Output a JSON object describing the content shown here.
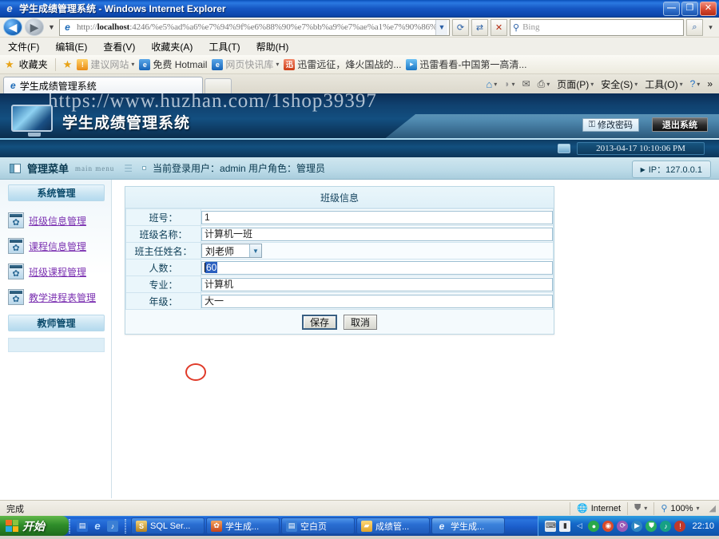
{
  "window": {
    "title": "学生成绩管理系统 - Windows Internet Explorer",
    "minimize_label": "—",
    "maximize_label": "❐",
    "close_label": "✕"
  },
  "address_bar": {
    "url_prefix": "http://",
    "url_host": "localhost",
    "url_rest": ":4246/%e5%ad%a6%e7%94%9f%e6%88%90%e7%bb%a9%e7%ae%a1%e7%90%86%e7%b3%bb",
    "dropdown_icon": "▼",
    "refresh_icon": "⟳",
    "stop_icon": "✕",
    "back_icon": "◀",
    "forward_icon": "▶",
    "history_icon": "▼"
  },
  "search": {
    "placeholder": "Bing",
    "icon": "search-icon",
    "go_icon": "⌕",
    "dropdown_icon": "▾"
  },
  "menu": {
    "items": [
      {
        "label": "文件(F)"
      },
      {
        "label": "编辑(E)"
      },
      {
        "label": "查看(V)"
      },
      {
        "label": "收藏夹(A)"
      },
      {
        "label": "工具(T)"
      },
      {
        "label": "帮助(H)"
      }
    ]
  },
  "favorites": {
    "label": "收藏夹",
    "items": [
      {
        "label": "建议网站",
        "icon": "lightbulb-icon",
        "has_arrow": true
      },
      {
        "label": "免费 Hotmail",
        "icon": "ie-icon",
        "has_arrow": false
      },
      {
        "label": "网页快讯库",
        "icon": "ie-icon",
        "has_arrow": true
      },
      {
        "label": "迅雷远征，烽火国战的...",
        "icon": "thunder-icon",
        "has_arrow": false
      },
      {
        "label": "迅雷看看-中国第一高清...",
        "icon": "thunder-play-icon",
        "has_arrow": false
      }
    ]
  },
  "tabs": {
    "active": "学生成绩管理系统",
    "new_tab_label": ""
  },
  "command_bar": {
    "items": [
      {
        "label": "",
        "icon": "home-icon",
        "arrow": "▾"
      },
      {
        "label": "",
        "icon": "feeds-icon",
        "arrow": "▾"
      },
      {
        "label": "",
        "icon": "mail-icon",
        "arrow": ""
      },
      {
        "label": "",
        "icon": "print-icon",
        "arrow": "▾"
      },
      {
        "label": "页面(P)",
        "icon": "",
        "arrow": "▾"
      },
      {
        "label": "安全(S)",
        "icon": "",
        "arrow": "▾"
      },
      {
        "label": "工具(O)",
        "icon": "",
        "arrow": "▾"
      },
      {
        "label": "",
        "icon": "help-icon",
        "arrow": "▾"
      }
    ],
    "overflow": "»"
  },
  "app_header": {
    "watermark": "https://www.huzhan.com/1shop39397",
    "title": "学生成绩管理系统",
    "change_password_label": "修改密码",
    "change_password_icon": "key-icon",
    "logout_label": "退出系统",
    "datetime": "2013-04-17 10:10:06 PM",
    "screen_icon": "monitor-icon"
  },
  "sub_header": {
    "menu_title": "管理菜单",
    "menu_subtitle": "main menu",
    "current_user_text": "当前登录用户：admin 用户角色：管理员",
    "ip_label": "IP：127.0.0.1",
    "ip_arrow": "▶"
  },
  "sidebar": {
    "groups": [
      {
        "type": "header",
        "label": "系统管理"
      },
      {
        "type": "item",
        "label": "班级信息管理",
        "icon": "gear-icon"
      },
      {
        "type": "item",
        "label": "课程信息管理",
        "icon": "gear-icon"
      },
      {
        "type": "item",
        "label": "班级课程管理",
        "icon": "gear-icon"
      },
      {
        "type": "item",
        "label": "教学进程表管理",
        "icon": "gear-icon"
      },
      {
        "type": "header",
        "label": "教师管理"
      }
    ]
  },
  "form": {
    "title": "班级信息",
    "fields": [
      {
        "label": "班号：",
        "value": "1",
        "type": "text"
      },
      {
        "label": "班级名称：",
        "value": "计算机一班",
        "type": "text"
      },
      {
        "label": "班主任姓名：",
        "value": "刘老师",
        "type": "select",
        "arrow": "▼"
      },
      {
        "label": "人数：",
        "value": "60",
        "type": "text-selected"
      },
      {
        "label": "专业：",
        "value": "计算机",
        "type": "text"
      },
      {
        "label": "年级：",
        "value": "大一",
        "type": "text"
      }
    ],
    "save_label": "保存",
    "cancel_label": "取消"
  },
  "status_bar": {
    "message": "完成",
    "zone": "Internet",
    "zone_icon": "globe-icon",
    "protected_icon": "lock-icon",
    "zoom": "100%",
    "zoom_icon": "magnifier-icon",
    "dropdown": "▾"
  },
  "taskbar": {
    "start_label": "开始",
    "quick_launch": [
      {
        "icon": "show-desktop-icon"
      },
      {
        "icon": "ie-icon"
      },
      {
        "icon": "media-icon"
      }
    ],
    "tasks": [
      {
        "label": "SQL Ser...",
        "icon": "sql-icon"
      },
      {
        "label": "学生成...",
        "icon": "vs-icon"
      },
      {
        "label": "空白页",
        "icon": "ie-blank-icon"
      },
      {
        "label": "成绩管...",
        "icon": "folder-icon"
      },
      {
        "label": "学生成...",
        "icon": "ie-icon"
      }
    ],
    "tray_icons": [
      "keyboard-icon",
      "battery-icon",
      "volume-icon",
      "antivirus-icon",
      "network-icon",
      "update-icon",
      "media-icon",
      "shield-icon",
      "sound-icon",
      "alert-icon"
    ],
    "clock": "22:10"
  },
  "colors": {
    "header_blue": "#10416f",
    "accent_link": "#7a2fb0",
    "annotation_red": "#e03b2a",
    "taskbar_blue": "#1b5ecb"
  }
}
